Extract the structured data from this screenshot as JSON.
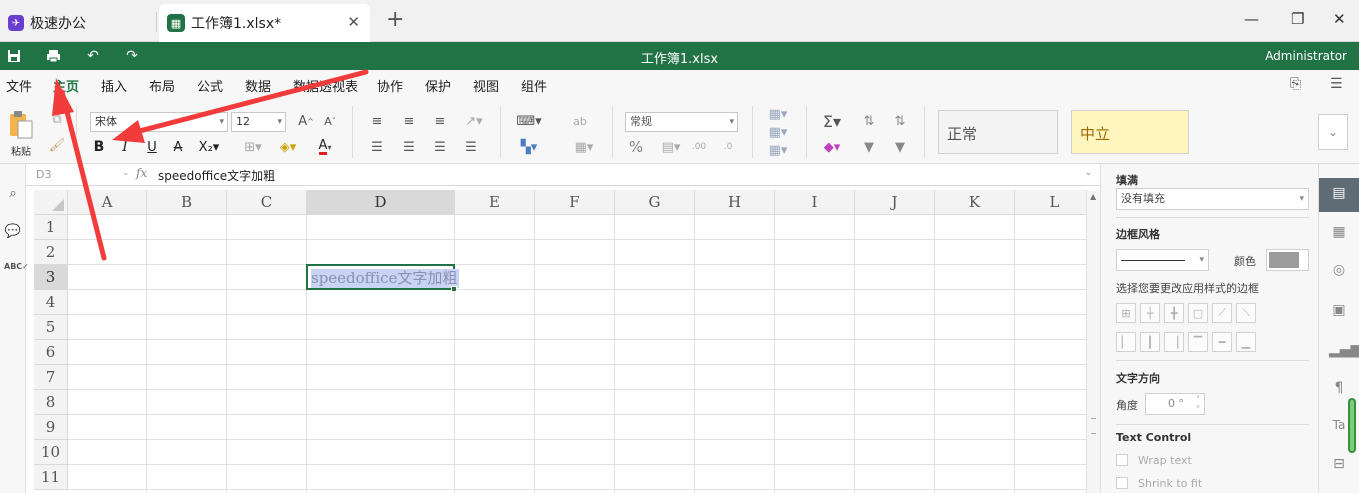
{
  "app": {
    "name": "极速办公",
    "file_tab": "工作簿1.xlsx*",
    "doc_title": "工作簿1.xlsx",
    "user": "Administrator"
  },
  "menu": [
    "文件",
    "主页",
    "插入",
    "布局",
    "公式",
    "数据",
    "数据透视表",
    "协作",
    "保护",
    "视图",
    "组件"
  ],
  "active_menu": "主页",
  "ribbon": {
    "paste_label": "粘贴",
    "font_name": "宋体",
    "font_size": "12",
    "number_format": "常规",
    "style_normal": "正常",
    "style_neutral": "中立"
  },
  "formula_bar": {
    "name_box": "D3",
    "fx": "fx",
    "content": "speedoffice文字加粗"
  },
  "sheet": {
    "columns": [
      "A",
      "B",
      "C",
      "D",
      "E",
      "F",
      "G",
      "H",
      "I",
      "J",
      "K",
      "L"
    ],
    "rows": [
      "1",
      "2",
      "3",
      "4",
      "5",
      "6",
      "7",
      "8",
      "9",
      "10",
      "11"
    ],
    "selected_column": "D",
    "selected_row": "3",
    "active_cell_text": "speedoffice文字加粗"
  },
  "panel": {
    "fill_title": "填满",
    "fill_value": "没有填充",
    "border_title": "边框风格",
    "color_label": "颜色",
    "border_hint": "选择您要更改应用样式的边框",
    "text_direction_title": "文字方向",
    "angle_label": "角度",
    "angle_value": "0 °",
    "text_control_title": "Text Control",
    "wrap_text": "Wrap text",
    "shrink_to_fit": "Shrink to fit"
  },
  "colors": {
    "brand_green": "#217346",
    "annotation_red": "#f23c3c",
    "selection_fill": "#c9d4f4"
  }
}
